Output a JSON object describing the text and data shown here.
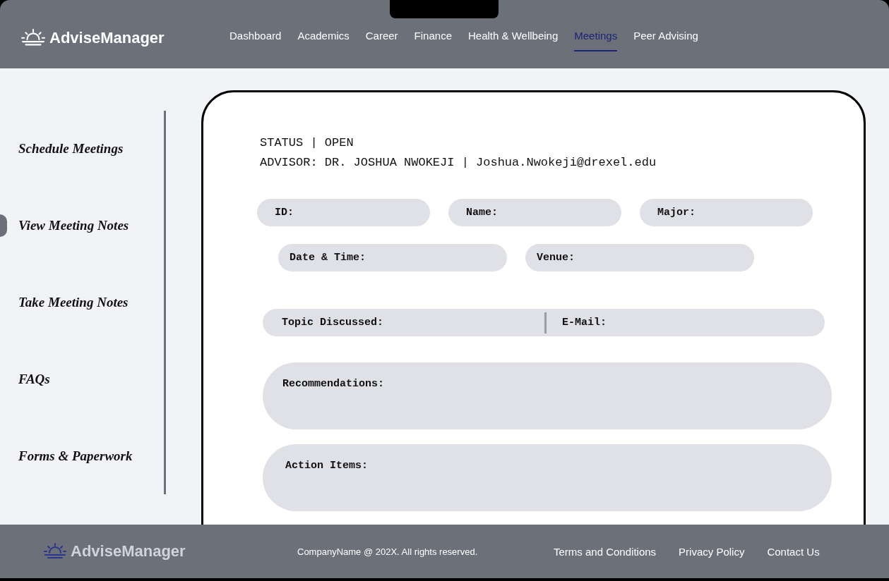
{
  "header": {
    "logo": "AdviseManager",
    "nav": [
      {
        "label": "Dashboard",
        "selected": false
      },
      {
        "label": "Academics",
        "selected": false
      },
      {
        "label": "Career",
        "selected": false
      },
      {
        "label": "Finance",
        "selected": false
      },
      {
        "label": "Health & Wellbeing",
        "selected": false
      },
      {
        "label": "Meetings",
        "selected": true
      },
      {
        "label": "Peer Advising",
        "selected": false
      }
    ]
  },
  "sidebar": {
    "items": [
      {
        "label": "Schedule Meetings",
        "selected": false
      },
      {
        "label": "View Meeting Notes",
        "selected": true
      },
      {
        "label": "Take Meeting Notes",
        "selected": false
      },
      {
        "label": "FAQs",
        "selected": false
      },
      {
        "label": "Forms & Paperwork",
        "selected": false
      }
    ]
  },
  "meeting": {
    "status": "STATUS | OPEN",
    "advisor": "ADVISOR: DR. JOSHUA NWOKEJI | Joshua.Nwokeji@drexel.edu",
    "field_rows": [
      {
        "kind": "pills",
        "fields": [
          "ID:",
          "Name:",
          "Major:"
        ]
      },
      {
        "kind": "pills",
        "fields": [
          "Date & Time:",
          "Venue:"
        ]
      },
      {
        "kind": "split",
        "fields": [
          "Topic Discussed:",
          "E-Mail:"
        ]
      },
      {
        "kind": "area",
        "fields": [
          "Recommendations:"
        ]
      },
      {
        "kind": "area",
        "fields": [
          "Action Items:"
        ]
      }
    ]
  },
  "footer": {
    "logo": "AdviseManager",
    "copyright": "CompanyName @ 202X. All rights reserved.",
    "links": [
      "Terms and Conditions",
      "Privacy Policy",
      "Contact Us"
    ]
  }
}
